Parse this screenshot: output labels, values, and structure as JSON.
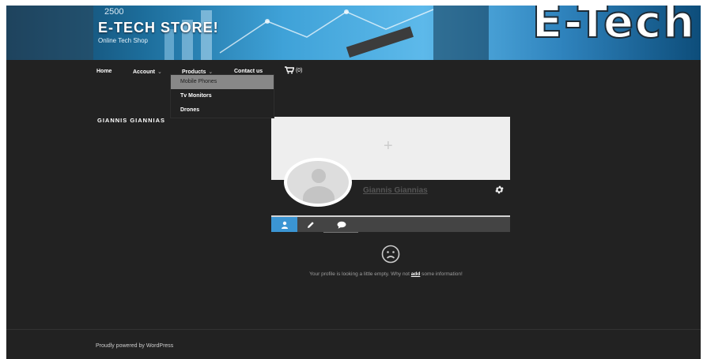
{
  "header": {
    "number": "2500",
    "site_title": "E-TECH STORE!",
    "site_description": "Online Tech Shop",
    "logo_text": "E-Tech"
  },
  "nav": {
    "items": [
      {
        "label": "Home"
      },
      {
        "label": "Account",
        "has_submenu": true
      },
      {
        "label": "Products",
        "has_submenu": true
      },
      {
        "label": "Contact us"
      }
    ],
    "cart_count": "(0)",
    "chevron": "⌄"
  },
  "products_menu": {
    "items": [
      {
        "label": "Mobile Phones",
        "highlighted": true
      },
      {
        "label": "Tv Monitors"
      },
      {
        "label": "Drones"
      }
    ]
  },
  "profile": {
    "heading": "GIANNIS GIANNIAS",
    "display_name": "Giannis Giannias",
    "cover_plus": "+",
    "settings_icon": "gear-icon",
    "tabs": [
      {
        "icon": "user-icon",
        "active": true
      },
      {
        "icon": "pencil-icon"
      },
      {
        "icon": "comment-icon"
      }
    ],
    "empty_message_before": "Your profile is looking a little empty. Why not ",
    "empty_message_link": "add",
    "empty_message_after": " some information!"
  },
  "footer": {
    "text": "Proudly powered by WordPress"
  },
  "colors": {
    "background": "#222222",
    "accent": "#3b95d3",
    "dropdown_highlight": "#888888"
  }
}
